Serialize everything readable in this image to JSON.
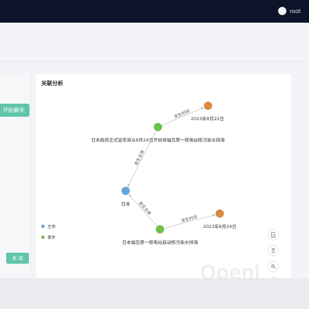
{
  "header": {
    "username": "root",
    "avatar_icon": "user-avatar"
  },
  "left": {
    "start_chat_button": "开始聊天",
    "submit_button": "发 送"
  },
  "panel": {
    "title": "关联分析"
  },
  "graph": {
    "nodes": [
      {
        "id": "event1",
        "label": "日本政府正式宣布将从8月24日开始将福岛第一核电站核污染水排海",
        "category": "事件",
        "color": "#6fbf4b"
      },
      {
        "id": "entity1",
        "label": "日本",
        "category": "主体",
        "color": "#6aa2dc"
      },
      {
        "id": "event2",
        "label": "日本福岛第一核电站启动核污染水排海",
        "category": "事件",
        "color": "#6fbf4b"
      },
      {
        "id": "time1",
        "label": "2023年8月22日",
        "category": "",
        "color": "#d98a43"
      },
      {
        "id": "time2",
        "label": "2023年8月24日",
        "category": "",
        "color": "#d98a43"
      }
    ],
    "edges": [
      {
        "from": "event1",
        "to": "time1",
        "label": "发生时间"
      },
      {
        "from": "event1",
        "to": "entity1",
        "label": "发生主体"
      },
      {
        "from": "event2",
        "to": "entity1",
        "label": "发生主体"
      },
      {
        "from": "event2",
        "to": "time2",
        "label": "发生时间"
      }
    ]
  },
  "legend": [
    {
      "label": "主体",
      "color": "#6aa2dc"
    },
    {
      "label": "事件",
      "color": "#6fbf4b"
    }
  ],
  "toolbar": [
    {
      "name": "save-image-icon"
    },
    {
      "name": "delete-icon"
    },
    {
      "name": "zoom-in-icon"
    },
    {
      "name": "zoom-out-icon"
    },
    {
      "name": "fit-view-icon"
    }
  ],
  "watermark": "Openl"
}
